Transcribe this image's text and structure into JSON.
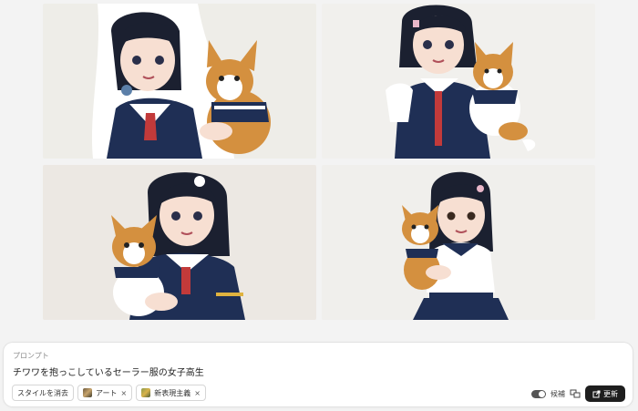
{
  "images": [
    {
      "name": "generated-image-1",
      "bg": "#eeede8"
    },
    {
      "name": "generated-image-2",
      "bg": "#f1f0ed"
    },
    {
      "name": "generated-image-3",
      "bg": "#ece8e3"
    },
    {
      "name": "generated-image-4",
      "bg": "#f0efec"
    }
  ],
  "prompt": {
    "label": "プロンプト",
    "text": "チワワを抱っこしているセーラー服の女子高生"
  },
  "chips": {
    "clear_style": "スタイルを消去",
    "art": "アート",
    "art_remove": "×",
    "neo_expressionism": "新表現主義",
    "neo_expressionism_remove": "×"
  },
  "controls": {
    "suggest_label": "候補",
    "update_label": "更新"
  },
  "colors": {
    "navy": "#1f2f55",
    "hair": "#1b2030",
    "dog_tan": "#d4903f",
    "red_tie": "#c23a3a",
    "update_bg": "#1e1e1e"
  }
}
